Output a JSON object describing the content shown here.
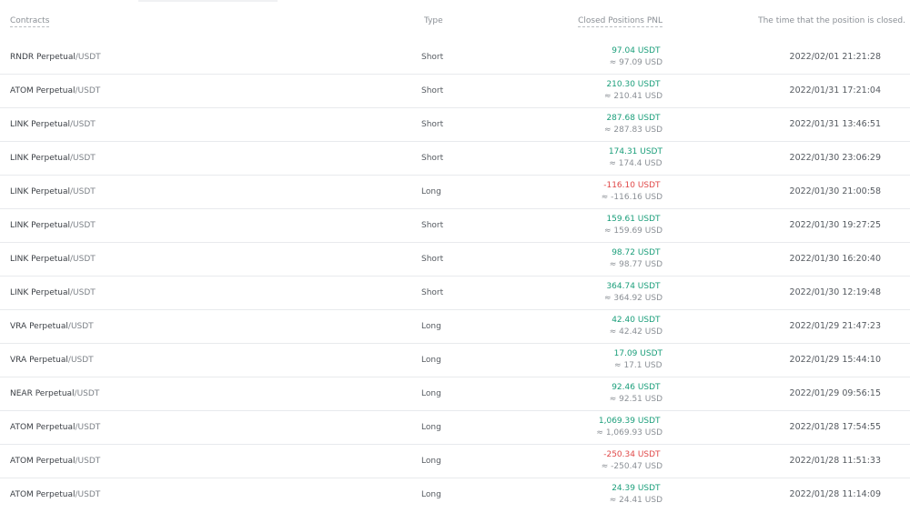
{
  "header": {
    "contracts": "Contracts",
    "type": "Type",
    "pnl": "Closed Positions PNL",
    "time": "The time that the position is closed."
  },
  "colors": {
    "positive": "#1a9e7a",
    "negative": "#e04848"
  },
  "rows": [
    {
      "base": "RNDR Perpetual",
      "quote": "/USDT",
      "type": "Short",
      "pnl": "97.04 USDT",
      "pnl_usd": "≈ 97.09 USD",
      "sign": "pos",
      "time": "2022/02/01 21:21:28"
    },
    {
      "base": "ATOM Perpetual",
      "quote": "/USDT",
      "type": "Short",
      "pnl": "210.30 USDT",
      "pnl_usd": "≈ 210.41 USD",
      "sign": "pos",
      "time": "2022/01/31 17:21:04"
    },
    {
      "base": "LINK Perpetual",
      "quote": "/USDT",
      "type": "Short",
      "pnl": "287.68 USDT",
      "pnl_usd": "≈ 287.83 USD",
      "sign": "pos",
      "time": "2022/01/31 13:46:51"
    },
    {
      "base": "LINK Perpetual",
      "quote": "/USDT",
      "type": "Short",
      "pnl": "174.31 USDT",
      "pnl_usd": "≈ 174.4 USD",
      "sign": "pos",
      "time": "2022/01/30 23:06:29"
    },
    {
      "base": "LINK Perpetual",
      "quote": "/USDT",
      "type": "Long",
      "pnl": "-116.10 USDT",
      "pnl_usd": "≈ -116.16 USD",
      "sign": "neg",
      "time": "2022/01/30 21:00:58"
    },
    {
      "base": "LINK Perpetual",
      "quote": "/USDT",
      "type": "Short",
      "pnl": "159.61 USDT",
      "pnl_usd": "≈ 159.69 USD",
      "sign": "pos",
      "time": "2022/01/30 19:27:25"
    },
    {
      "base": "LINK Perpetual",
      "quote": "/USDT",
      "type": "Short",
      "pnl": "98.72 USDT",
      "pnl_usd": "≈ 98.77 USD",
      "sign": "pos",
      "time": "2022/01/30 16:20:40"
    },
    {
      "base": "LINK Perpetual",
      "quote": "/USDT",
      "type": "Short",
      "pnl": "364.74 USDT",
      "pnl_usd": "≈ 364.92 USD",
      "sign": "pos",
      "time": "2022/01/30 12:19:48"
    },
    {
      "base": "VRA Perpetual",
      "quote": "/USDT",
      "type": "Long",
      "pnl": "42.40 USDT",
      "pnl_usd": "≈ 42.42 USD",
      "sign": "pos",
      "time": "2022/01/29 21:47:23"
    },
    {
      "base": "VRA Perpetual",
      "quote": "/USDT",
      "type": "Long",
      "pnl": "17.09 USDT",
      "pnl_usd": "≈ 17.1 USD",
      "sign": "pos",
      "time": "2022/01/29 15:44:10"
    },
    {
      "base": "NEAR Perpetual",
      "quote": "/USDT",
      "type": "Long",
      "pnl": "92.46 USDT",
      "pnl_usd": "≈ 92.51 USD",
      "sign": "pos",
      "time": "2022/01/29 09:56:15"
    },
    {
      "base": "ATOM Perpetual",
      "quote": "/USDT",
      "type": "Long",
      "pnl": "1,069.39 USDT",
      "pnl_usd": "≈ 1,069.93 USD",
      "sign": "pos",
      "time": "2022/01/28 17:54:55"
    },
    {
      "base": "ATOM Perpetual",
      "quote": "/USDT",
      "type": "Long",
      "pnl": "-250.34 USDT",
      "pnl_usd": "≈ -250.47 USD",
      "sign": "neg",
      "time": "2022/01/28 11:51:33"
    },
    {
      "base": "ATOM Perpetual",
      "quote": "/USDT",
      "type": "Long",
      "pnl": "24.39 USDT",
      "pnl_usd": "≈ 24.41 USD",
      "sign": "pos",
      "time": "2022/01/28 11:14:09"
    }
  ]
}
